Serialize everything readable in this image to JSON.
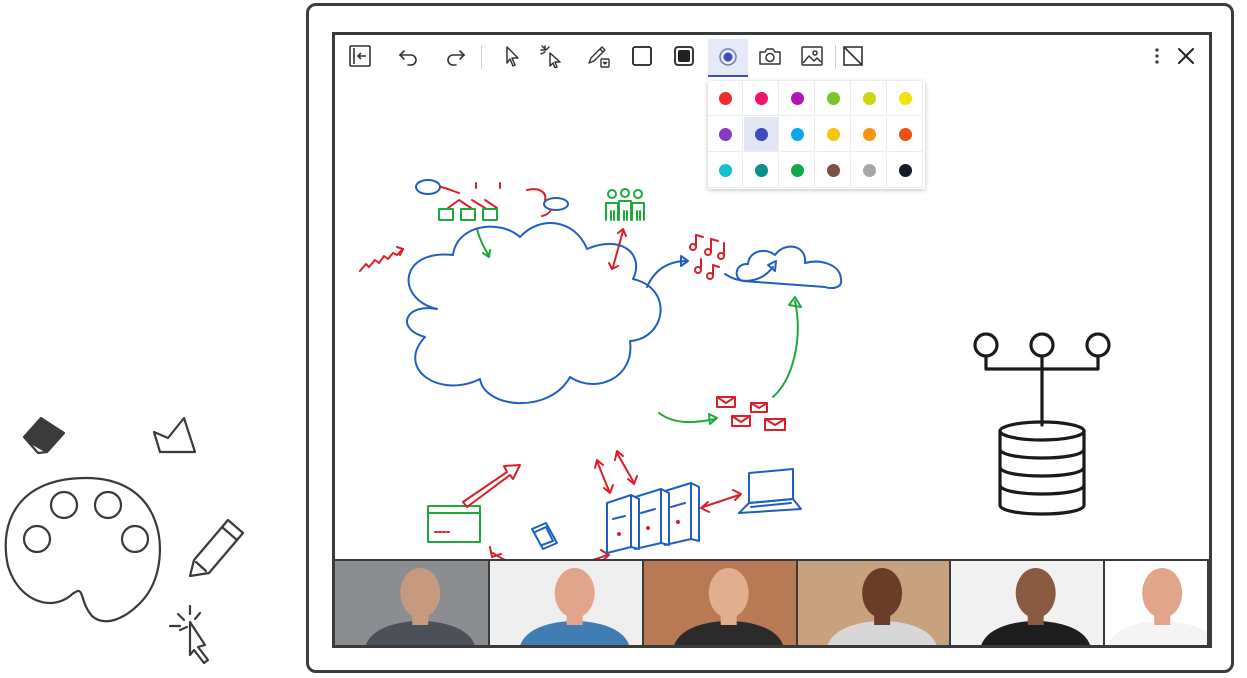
{
  "toolbar": {
    "buttons": [
      {
        "id": "collapse",
        "icon": "panel-collapse-icon"
      },
      {
        "id": "undo",
        "icon": "undo-icon"
      },
      {
        "id": "redo",
        "icon": "redo-icon"
      },
      {
        "id": "select",
        "icon": "select-pointer-icon"
      },
      {
        "id": "laser",
        "icon": "laser-pointer-icon"
      },
      {
        "id": "pen",
        "icon": "pencil-dropdown-icon"
      },
      {
        "id": "shape-outline",
        "icon": "square-outline-icon"
      },
      {
        "id": "shape-fill",
        "icon": "square-filled-icon"
      },
      {
        "id": "color",
        "icon": "color-picker-icon",
        "active": true
      },
      {
        "id": "camera",
        "icon": "camera-icon"
      },
      {
        "id": "image",
        "icon": "image-icon"
      },
      {
        "id": "clear",
        "icon": "clear-board-icon"
      },
      {
        "id": "more",
        "icon": "more-vertical-icon"
      },
      {
        "id": "close",
        "icon": "close-icon"
      }
    ]
  },
  "palette": {
    "selected": "#3e4bc2",
    "rows": [
      [
        "#f02b2b",
        "#f0136b",
        "#b414b4",
        "#7bc42a",
        "#c9d611",
        "#f5e20c"
      ],
      [
        "#8a38c6",
        "#3e4bc2",
        "#0ba7ef",
        "#f5c30c",
        "#f7930f",
        "#f04d12"
      ],
      [
        "#12c0cd",
        "#0f8f89",
        "#12a84a",
        "#7a5143",
        "#a6a6a6",
        "#121d27"
      ]
    ]
  },
  "participants": [
    {
      "name": "participant-1",
      "skin": "#c79a80",
      "bg": "#8a8e91",
      "shirt": "#4c5058"
    },
    {
      "name": "participant-2",
      "skin": "#e0a58a",
      "bg": "#eeeeee",
      "shirt": "#3f7db3"
    },
    {
      "name": "participant-3",
      "skin": "#e2ae90",
      "bg": "#b87a55",
      "shirt": "#2b2b2b"
    },
    {
      "name": "participant-4",
      "skin": "#6a3d28",
      "bg": "#c8a27e",
      "shirt": "#d7d7d7"
    },
    {
      "name": "participant-5",
      "skin": "#8a5a42",
      "bg": "#f1f1f1",
      "shirt": "#1e1e1e"
    },
    {
      "name": "participant-6",
      "skin": "#e0a58a",
      "bg": "#ffffff",
      "shirt": "#f4f4f4"
    }
  ]
}
